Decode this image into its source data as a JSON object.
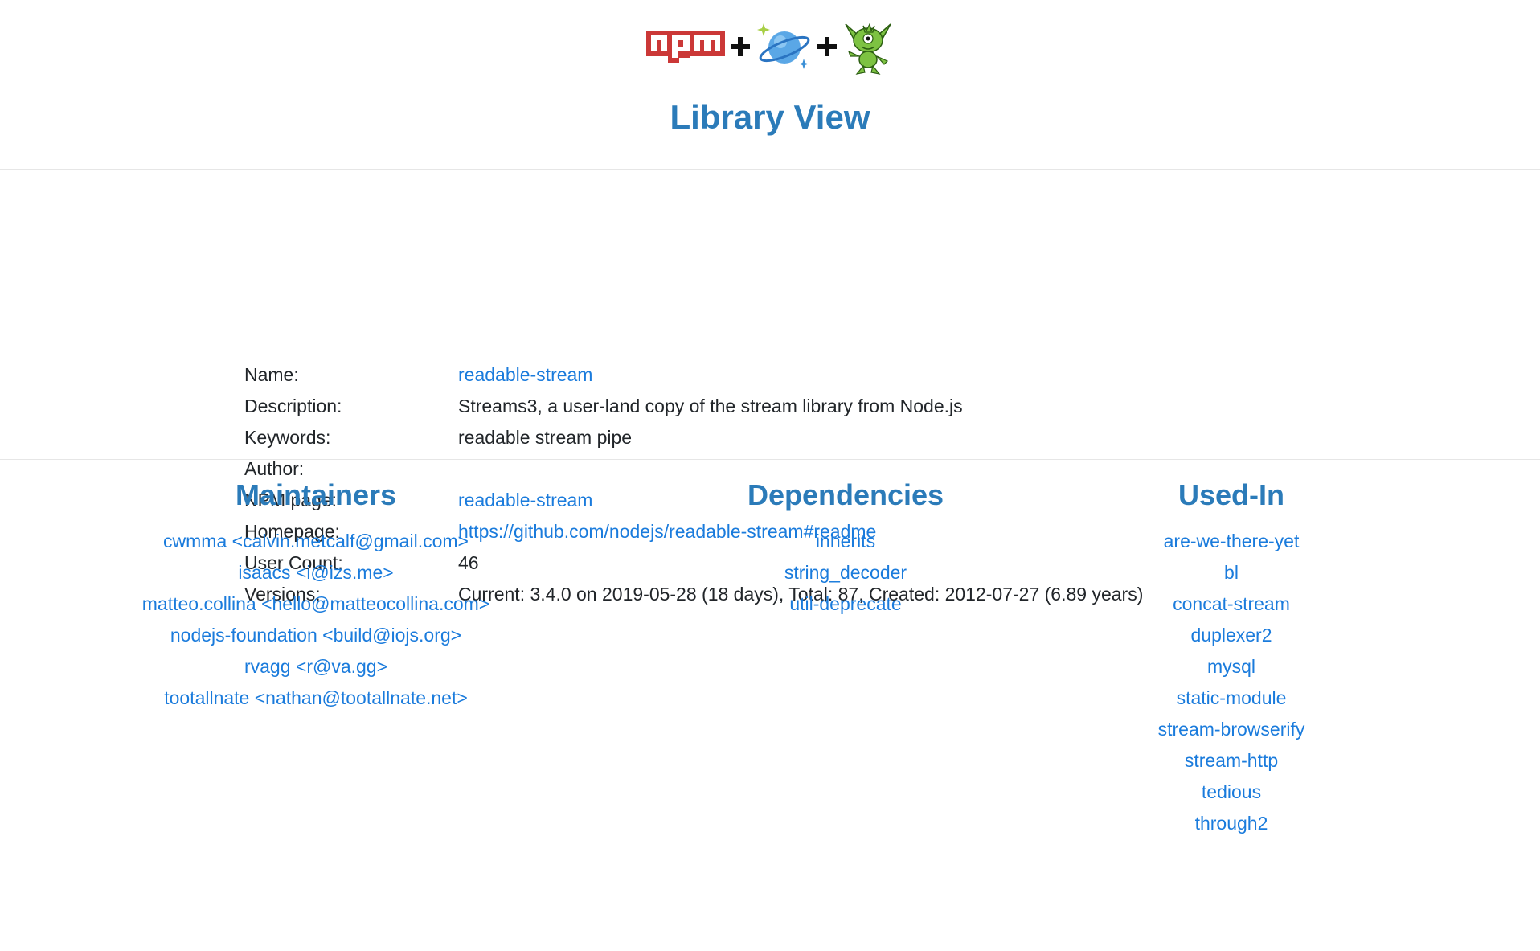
{
  "header": {
    "title": "Library View"
  },
  "details": {
    "name_label": "Name:",
    "name_value": "readable-stream",
    "description_label": "Description:",
    "description_value": "Streams3, a user-land copy of the stream library from Node.js",
    "keywords_label": "Keywords:",
    "keywords_value": "readable stream pipe",
    "author_label": "Author:",
    "author_value": "",
    "npm_page_label": "NPM page:",
    "npm_page_value": "readable-stream",
    "homepage_label": "Homepage:",
    "homepage_value": "https://github.com/nodejs/readable-stream#readme",
    "user_count_label": "User Count:",
    "user_count_value": "46",
    "versions_label": "Versions:",
    "versions_value": "Current: 3.4.0 on 2019-05-28 (18 days), Total: 87, Created: 2012-07-27 (6.89 years)"
  },
  "maintainers": {
    "heading": "Maintainers",
    "items": [
      "cwmma <calvin.metcalf@gmail.com>",
      "isaacs <i@izs.me>",
      "matteo.collina <hello@matteocollina.com>",
      "nodejs-foundation <build@iojs.org>",
      "rvagg <r@va.gg>",
      "tootallnate <nathan@tootallnate.net>"
    ]
  },
  "dependencies": {
    "heading": "Dependencies",
    "items": [
      "inherits",
      "string_decoder",
      "util-deprecate"
    ]
  },
  "used_in": {
    "heading": "Used-In",
    "items": [
      "are-we-there-yet",
      "bl",
      "concat-stream",
      "duplexer2",
      "mysql",
      "static-module",
      "stream-browserify",
      "stream-http",
      "tedious",
      "through2"
    ]
  },
  "colors": {
    "heading": "#2b7bb9",
    "link": "#1a7bdc",
    "npm_red": "#cb3837",
    "planet_blue": "#3a8fd6",
    "gremlin_green": "#7dc242"
  },
  "logos": [
    "npm-logo",
    "plus-icon",
    "cosmos-planet-logo",
    "plus-icon",
    "gremlin-logo"
  ]
}
